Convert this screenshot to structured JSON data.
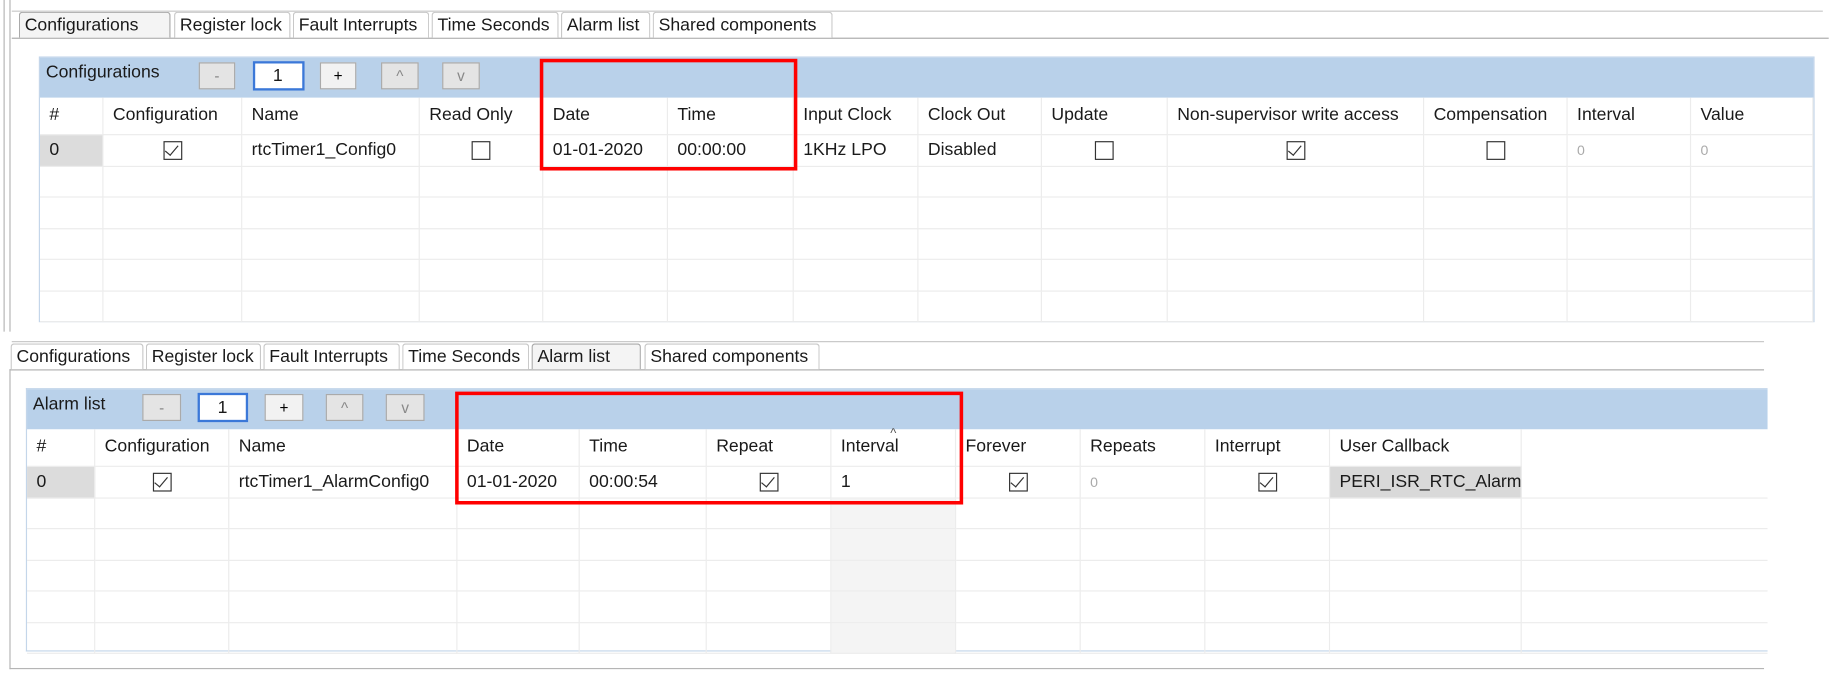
{
  "top_panel": {
    "tabs": [
      "Configurations",
      "Register lock",
      "Fault Interrupts",
      "Time Seconds",
      "Alarm list",
      "Shared components"
    ],
    "active_tab": 0,
    "section_title": "Configurations",
    "toolbar": {
      "remove_label": "-",
      "count_value": "1",
      "add_label": "+",
      "up_label": "^",
      "down_label": "v"
    },
    "columns": [
      "#",
      "Configuration",
      "Name",
      "Read Only",
      "Date",
      "Time",
      "Input Clock",
      "Clock Out",
      "Update",
      "Non-supervisor write access",
      "Compensation",
      "Interval",
      "Value"
    ],
    "rows": [
      [
        "0",
        true,
        "rtcTimer1_Config0",
        false,
        "01-01-2020",
        "00:00:00",
        "1KHz LPO",
        "Disabled",
        false,
        true,
        false,
        "0",
        "0"
      ]
    ]
  },
  "bottom_panel": {
    "tabs": [
      "Configurations",
      "Register lock",
      "Fault Interrupts",
      "Time Seconds",
      "Alarm list",
      "Shared components"
    ],
    "active_tab": 4,
    "section_title": "Alarm list",
    "toolbar": {
      "remove_label": "-",
      "count_value": "1",
      "add_label": "+",
      "up_label": "^",
      "down_label": "v"
    },
    "columns": [
      "#",
      "Configuration",
      "Name",
      "Date",
      "Time",
      "Repeat",
      "Interval",
      "Forever",
      "Repeats",
      "Interrupt",
      "User Callback"
    ],
    "sort_indicator": "^",
    "rows": [
      [
        "0",
        true,
        "rtcTimer1_AlarmConfig0",
        "01-01-2020",
        "00:00:54",
        true,
        "1",
        true,
        "0",
        true,
        "PERI_ISR_RTC_Alarm"
      ]
    ]
  },
  "colors": {
    "highlight_box": "#ff0000",
    "header_bar": "#b9d1ea"
  }
}
